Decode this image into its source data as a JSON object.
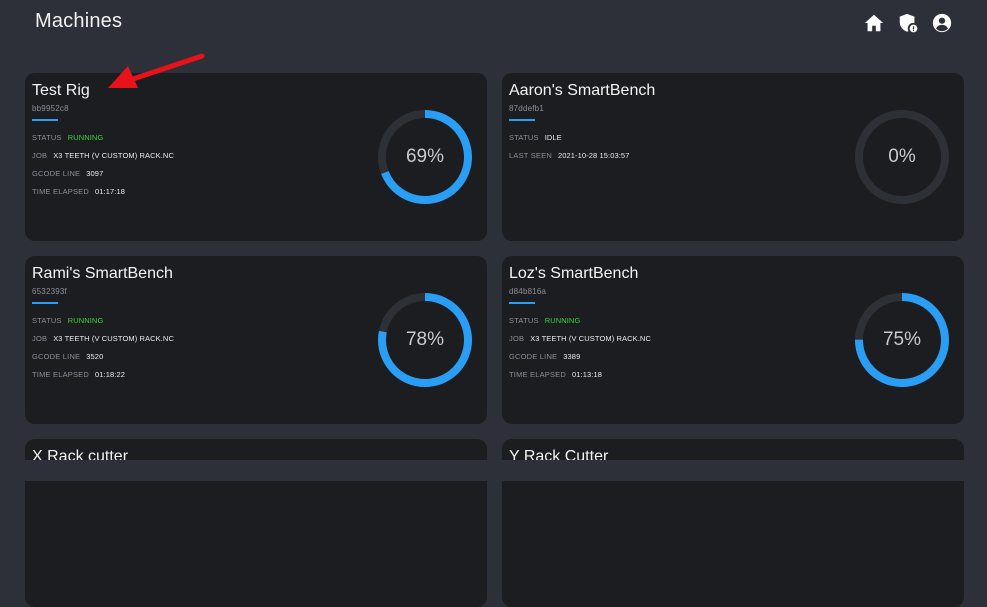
{
  "header": {
    "title": "Machines",
    "icons": [
      "home-icon",
      "shield-notification-icon",
      "account-icon"
    ]
  },
  "colors": {
    "background": "#2d3038",
    "card": "#1c1d21",
    "accent": "#2a9df4",
    "running": "#3ad23a",
    "track": "#2e3038",
    "annotation_arrow": "#e8121a"
  },
  "machines": [
    {
      "name": "Test Rig",
      "id": "bb9952c8",
      "rows": [
        {
          "label": "STATUS",
          "value": "RUNNING"
        },
        {
          "label": "JOB",
          "value": "X3 TEETH (V CUSTOM) RACK.NC"
        },
        {
          "label": "GCODE LINE",
          "value": "3097"
        },
        {
          "label": "TIME ELAPSED",
          "value": "01:17:18"
        }
      ],
      "progress": 69,
      "progress_label": "69%"
    },
    {
      "name": "Aaron's SmartBench",
      "id": "87ddefb1",
      "rows": [
        {
          "label": "STATUS",
          "value": "IDLE"
        },
        {
          "label": "LAST SEEN",
          "value": "2021-10-28 15:03:57"
        }
      ],
      "progress": 0,
      "progress_label": "0%"
    },
    {
      "name": "Rami's SmartBench",
      "id": "6532393f",
      "rows": [
        {
          "label": "STATUS",
          "value": "RUNNING"
        },
        {
          "label": "JOB",
          "value": "X3 TEETH (V CUSTOM) RACK.NC"
        },
        {
          "label": "GCODE LINE",
          "value": "3520"
        },
        {
          "label": "TIME ELAPSED",
          "value": "01:18:22"
        }
      ],
      "progress": 78,
      "progress_label": "78%"
    },
    {
      "name": "Loz's SmartBench",
      "id": "d84b816a",
      "rows": [
        {
          "label": "STATUS",
          "value": "RUNNING"
        },
        {
          "label": "JOB",
          "value": "X3 TEETH (V CUSTOM) RACK.NC"
        },
        {
          "label": "GCODE LINE",
          "value": "3389"
        },
        {
          "label": "TIME ELAPSED",
          "value": "01:13:18"
        }
      ],
      "progress": 75,
      "progress_label": "75%"
    },
    {
      "name": "X Rack cutter",
      "id": "",
      "rows": [],
      "progress": null,
      "progress_label": ""
    },
    {
      "name": "Y Rack Cutter",
      "id": "",
      "rows": [],
      "progress": null,
      "progress_label": ""
    }
  ]
}
